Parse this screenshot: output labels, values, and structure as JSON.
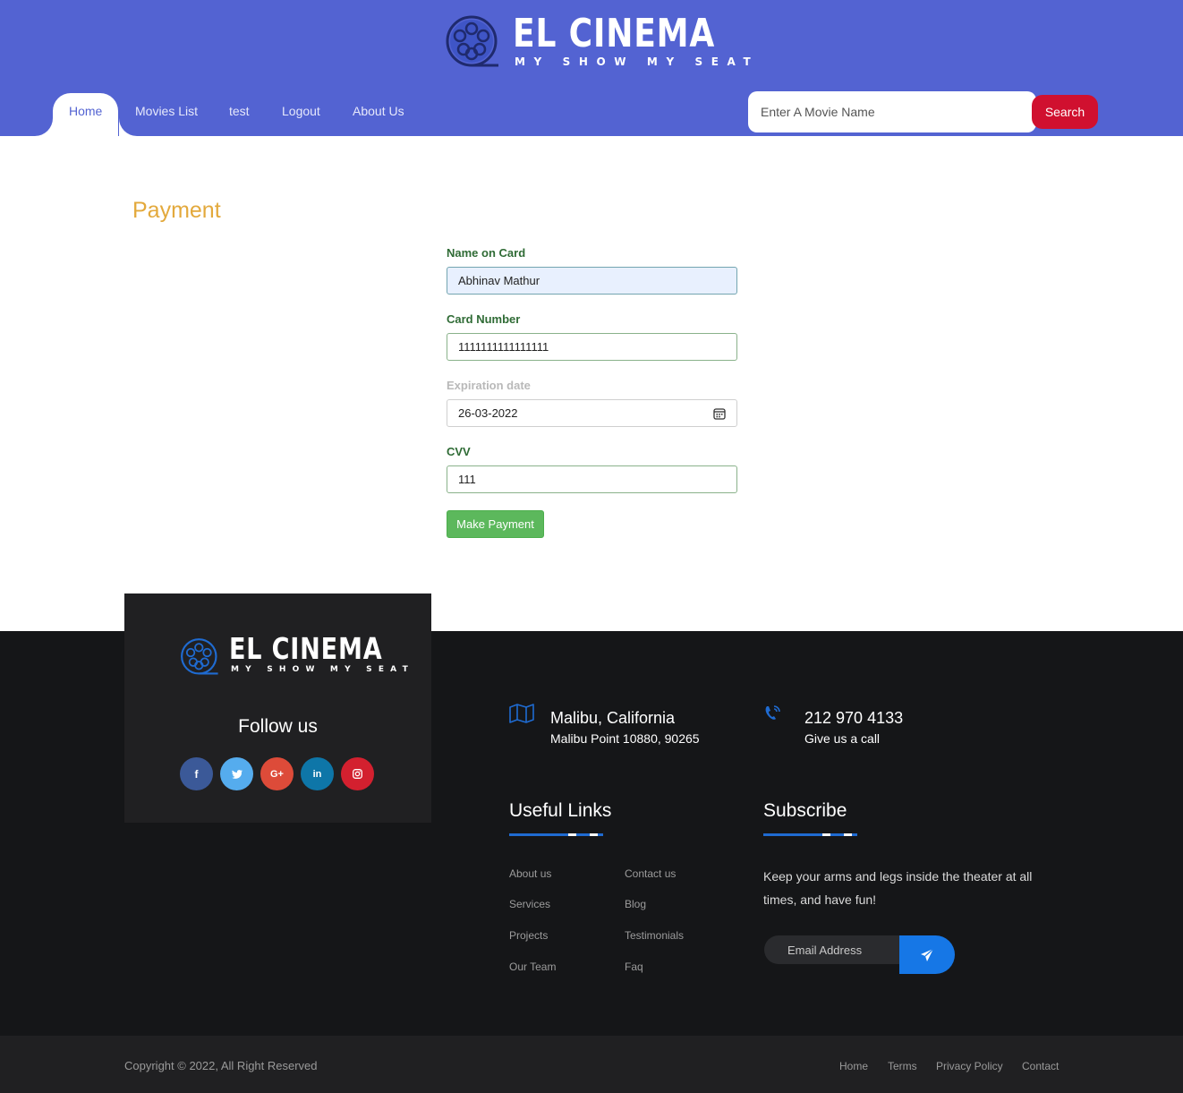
{
  "brand": {
    "name": "EL CINEMA",
    "tagline": "MY SHOW MY SEAT"
  },
  "nav": {
    "items": [
      {
        "label": "Home",
        "active": true
      },
      {
        "label": "Movies List",
        "active": false
      },
      {
        "label": "test",
        "active": false
      },
      {
        "label": "Logout",
        "active": false
      },
      {
        "label": "About Us",
        "active": false
      }
    ],
    "search_placeholder": "Enter A Movie Name",
    "search_label": "Search"
  },
  "payment": {
    "title": "Payment",
    "name_label": "Name on Card",
    "name_value": "Abhinav Mathur",
    "card_label": "Card Number",
    "card_value": "1111111111111111",
    "expiry_label": "Expiration date",
    "expiry_value": "26-03-2022",
    "cvv_label": "CVV",
    "cvv_value": "111",
    "submit_label": "Make Payment"
  },
  "footer": {
    "follow_title": "Follow us",
    "socials": [
      "facebook",
      "twitter",
      "google-plus",
      "linkedin",
      "instagram"
    ],
    "location_title": "Malibu, California",
    "location_sub": "Malibu Point 10880, 90265",
    "phone_title": "212 970 4133",
    "phone_sub": "Give us a call",
    "links_title": "Useful Links",
    "links_col1": [
      "About us",
      "Services",
      "Projects",
      "Our Team"
    ],
    "links_col2": [
      "Contact us",
      "Blog",
      "Testimonials",
      "Faq"
    ],
    "subscribe_title": "Subscribe",
    "subscribe_text": "Keep your arms and legs inside the theater at all times, and have fun!",
    "email_placeholder": "Email Address",
    "copyright": "Copyright © 2022, All Right Reserved",
    "bottom_links": [
      "Home",
      "Terms",
      "Privacy Policy",
      "Contact"
    ]
  },
  "colors": {
    "header_bg": "#5363d2",
    "search_button": "#d0102f",
    "title_gold": "#e3a93c",
    "label_green": "#2f6b35",
    "pay_button": "#5cb85c",
    "footer_bg": "#151618",
    "accent_blue": "#1677e6"
  }
}
